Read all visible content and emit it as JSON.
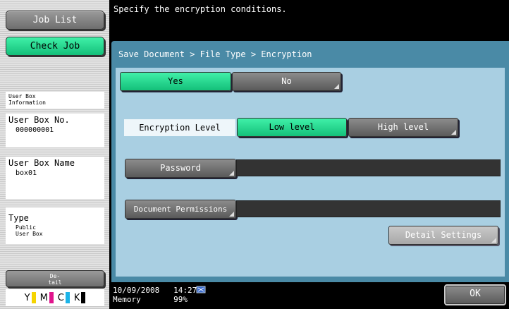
{
  "left_panel": {
    "job_list": "Job List",
    "check_job": "Check Job",
    "user_box_info": "User Box Information",
    "box_no_label": "User Box No.",
    "box_no_value": "000000001",
    "box_name_label": "User Box Name",
    "box_name_value": "box01",
    "type_label": "Type",
    "type_value": "Public User Box",
    "detail_button": "De-tail",
    "toner": [
      {
        "letter": "Y",
        "color": "#f5d400"
      },
      {
        "letter": "M",
        "color": "#e0148c"
      },
      {
        "letter": "C",
        "color": "#1cb4e8"
      },
      {
        "letter": "K",
        "color": "#000000"
      }
    ]
  },
  "message": "Specify the encryption conditions.",
  "breadcrumb": "Save Document > File Type > Encryption",
  "encryption": {
    "yes": "Yes",
    "no": "No",
    "level_label": "Encryption Level",
    "low": "Low level",
    "high": "High level",
    "password": "Password",
    "permissions": "Document Permissions",
    "detail_settings": "Detail Settings"
  },
  "status": {
    "date": "10/09/2008",
    "time": "14:27",
    "memory_label": "Memory",
    "memory_value": "99%"
  },
  "ok": "OK",
  "colors": {
    "accent_green": "#2ad890",
    "panel_blue": "#4a8aa6",
    "panel_light": "#a9cfe2"
  }
}
